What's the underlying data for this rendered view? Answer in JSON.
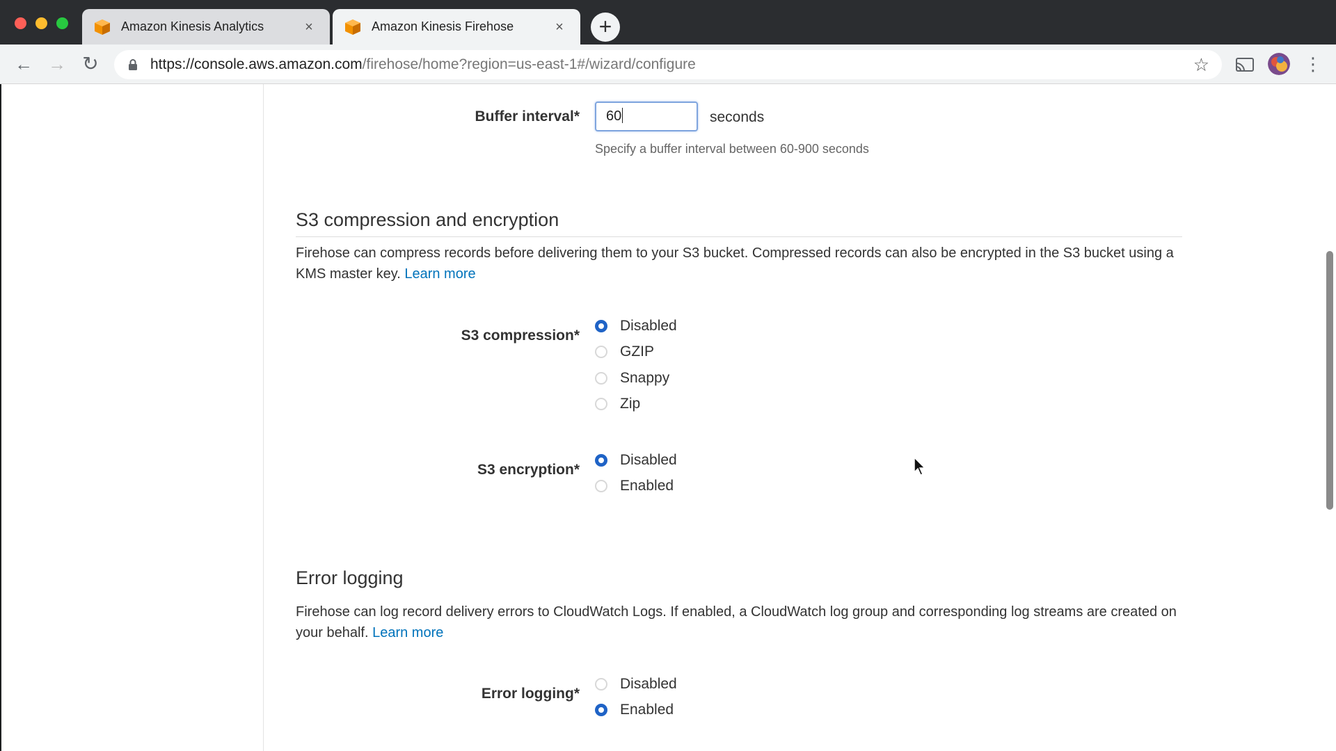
{
  "browser": {
    "tabs": [
      {
        "title": "Amazon Kinesis Analytics",
        "close": "×",
        "icon": "aws-cube-icon"
      },
      {
        "title": "Amazon Kinesis Firehose",
        "close": "×",
        "icon": "aws-cube-icon"
      }
    ],
    "new_tab": "+",
    "url_host": "https://console.aws.amazon.com",
    "url_path": "/firehose/home?region=us-east-1#/wizard/configure",
    "icons": {
      "back": "←",
      "forward": "→",
      "reload": "↻",
      "bookmark": "☆",
      "menu": "⋮"
    }
  },
  "buffer": {
    "label": "Buffer interval*",
    "value": "60",
    "unit": "seconds",
    "hint": "Specify a buffer interval between 60-900 seconds"
  },
  "compression_section": {
    "title": "S3 compression and encryption",
    "description": "Firehose can compress records before delivering them to your S3 bucket. Compressed records can also be encrypted in the S3 bucket using a KMS master key.",
    "link": "Learn more"
  },
  "s3_compression": {
    "label": "S3 compression*",
    "options": [
      "Disabled",
      "GZIP",
      "Snappy",
      "Zip"
    ],
    "selected": "Disabled"
  },
  "s3_encryption": {
    "label": "S3 encryption*",
    "options": [
      "Disabled",
      "Enabled"
    ],
    "selected": "Disabled"
  },
  "error_section": {
    "title": "Error logging",
    "description": "Firehose can log record delivery errors to CloudWatch Logs. If enabled, a CloudWatch log group and corresponding log streams are created on your behalf.",
    "link": "Learn more"
  },
  "error_logging": {
    "label": "Error logging*",
    "options": [
      "Disabled",
      "Enabled"
    ],
    "selected": "Enabled"
  },
  "colors": {
    "accent": "#1f63c6",
    "link": "#0073bb",
    "aws_orange": "#f29100"
  }
}
